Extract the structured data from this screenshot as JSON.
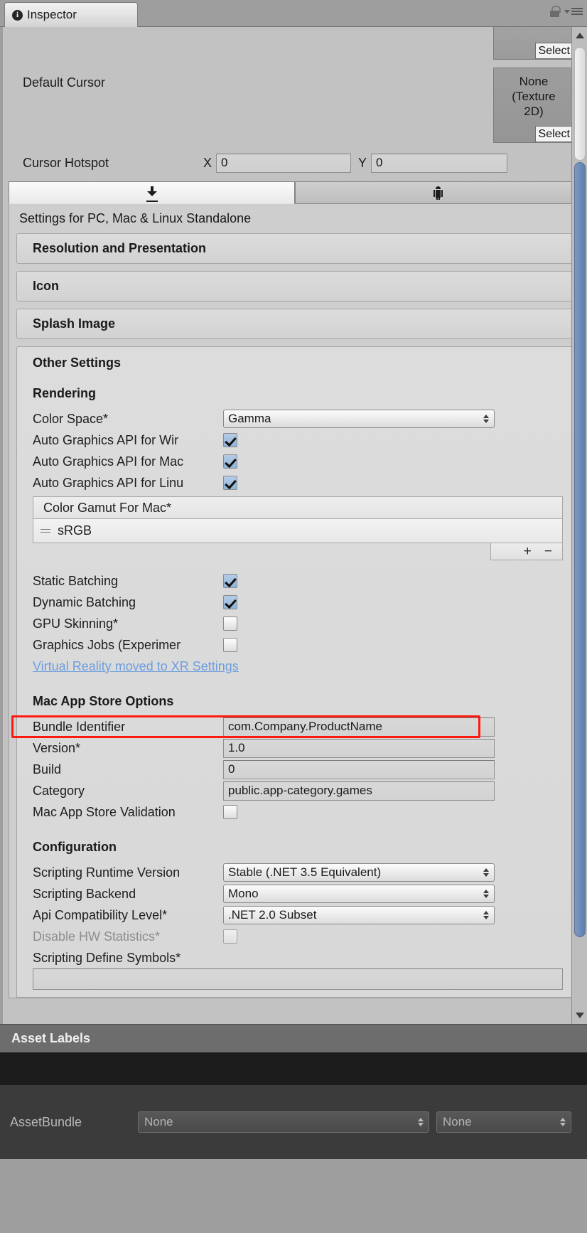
{
  "window": {
    "tab_title": "Inspector",
    "info_glyph": "i",
    "lock_icon": "lock-icon",
    "menu_icon": "hamburger-menu-icon"
  },
  "cursor_section": {
    "default_cursor_label": "Default Cursor",
    "top_select_label": "Select",
    "object_field_value": "None\n(Texture 2D)",
    "object_field_line1": "None",
    "object_field_line2": "(Texture",
    "object_field_line3": "2D)",
    "object_select_label": "Select",
    "hotspot_label": "Cursor Hotspot",
    "x_label": "X",
    "x_value": "0",
    "y_label": "Y",
    "y_value": "0"
  },
  "platform_tabs": [
    {
      "icon": "standalone-download-icon",
      "active": true
    },
    {
      "icon": "android-robot-icon",
      "active": false
    }
  ],
  "settings": {
    "settings_for": "Settings for PC, Mac & Linux Standalone",
    "foldouts": [
      "Resolution and Presentation",
      "Icon",
      "Splash Image"
    ],
    "other_settings_title": "Other Settings",
    "rendering": {
      "heading": "Rendering",
      "color_space_label": "Color Space*",
      "color_space_value": "Gamma",
      "auto_gfx_windows_label": "Auto Graphics API for Wir",
      "auto_gfx_windows_checked": true,
      "auto_gfx_mac_label": "Auto Graphics API for Mac",
      "auto_gfx_mac_checked": true,
      "auto_gfx_linux_label": "Auto Graphics API for Linu",
      "auto_gfx_linux_checked": true,
      "color_gamut_header": "Color Gamut For Mac*",
      "color_gamut_items": [
        "sRGB"
      ],
      "list_add_label": "+",
      "list_remove_label": "−",
      "static_batching_label": "Static Batching",
      "static_batching_checked": true,
      "dynamic_batching_label": "Dynamic Batching",
      "dynamic_batching_checked": true,
      "gpu_skinning_label": "GPU Skinning*",
      "gpu_skinning_checked": false,
      "graphics_jobs_label": "Graphics Jobs (Experimer",
      "graphics_jobs_checked": false,
      "xr_link_text": "Virtual Reality moved to XR Settings"
    },
    "mac_app_store": {
      "heading": "Mac App Store Options",
      "bundle_identifier_label": "Bundle Identifier",
      "bundle_identifier_value": "com.Company.ProductName",
      "version_label": "Version*",
      "version_value": "1.0",
      "build_label": "Build",
      "build_value": "0",
      "category_label": "Category",
      "category_value": "public.app-category.games",
      "validation_label": "Mac App Store Validation",
      "validation_checked": false
    },
    "configuration": {
      "heading": "Configuration",
      "scripting_runtime_label": "Scripting Runtime Version",
      "scripting_runtime_value": "Stable (.NET 3.5 Equivalent)",
      "scripting_backend_label": "Scripting Backend",
      "scripting_backend_value": "Mono",
      "api_compat_label": "Api Compatibility Level*",
      "api_compat_value": ".NET 2.0 Subset",
      "disable_hw_stats_label": "Disable HW Statistics*",
      "disable_hw_stats_checked": false,
      "disable_hw_stats_disabled": true,
      "define_symbols_label": "Scripting Define Symbols*",
      "define_symbols_value": ""
    }
  },
  "highlight": {
    "color": "#ff1a11",
    "target": "Bundle Identifier"
  },
  "footer": {
    "asset_labels_title": "Asset Labels",
    "tag_icon": "label-tag-icon",
    "asset_bundle_label": "AssetBundle",
    "asset_bundle_value": "None",
    "asset_bundle_variant_value": "None"
  }
}
